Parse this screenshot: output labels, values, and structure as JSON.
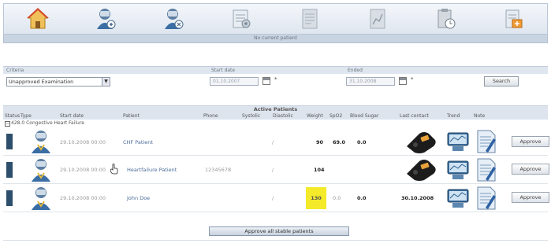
{
  "toolbar": {
    "icons": [
      "home-icon",
      "patient-add-icon",
      "patient-edit-icon",
      "settings-icon",
      "report-icon",
      "report-chart-icon",
      "clipboard-icon",
      "export-icon"
    ]
  },
  "status_text": "No current patient",
  "filter": {
    "criteria_label": "Criteria",
    "start_label": "Start date",
    "end_label": "Ended",
    "criteria_value": "Unapproved Examination",
    "start_value": "01.10.2007",
    "end_value": "31.10.2008",
    "search_label": "Search"
  },
  "table": {
    "title": "Active Patients",
    "columns": {
      "status": "Status",
      "type": "Type",
      "start_date": "Start date",
      "patient": "Patient",
      "phone": "Phone",
      "systolic": "Systolic",
      "diastolic": "Diastolic",
      "weight": "Weight",
      "spo2": "SpO2",
      "blood_sugar": "Blood Sugar",
      "last_contact": "Last contact",
      "trend": "Trend",
      "note": "Note"
    },
    "group": "428.0 Congestive Heart Failure",
    "rows": [
      {
        "start_date": "29.10.2008 00:00",
        "patient": "CHF Patient",
        "phone": "",
        "systolic": "",
        "diastolic": "/",
        "weight": "90",
        "spo2": "69.0",
        "blood_sugar": "0.0",
        "last_contact": "",
        "approve": "Approve"
      },
      {
        "start_date": "29.10.2008 00:00",
        "patient": "Heartfailure Patient",
        "phone": "12345678",
        "systolic": "",
        "diastolic": "/",
        "weight": "104",
        "spo2": "",
        "blood_sugar": "",
        "last_contact": "",
        "approve": "Approve"
      },
      {
        "start_date": "29.10.2008 00:00",
        "patient": "John Doe",
        "phone": "",
        "systolic": "",
        "diastolic": "/",
        "weight": "130",
        "spo2": "0.0",
        "blood_sugar": "0.0",
        "last_contact": "30.10.2008",
        "approve": "Approve"
      }
    ],
    "approve_all": "Approve all stable patients"
  },
  "colors": {
    "status_bar": "#2d4f6b",
    "highlight": "#f4ea2a",
    "link": "#4a6a9a"
  }
}
